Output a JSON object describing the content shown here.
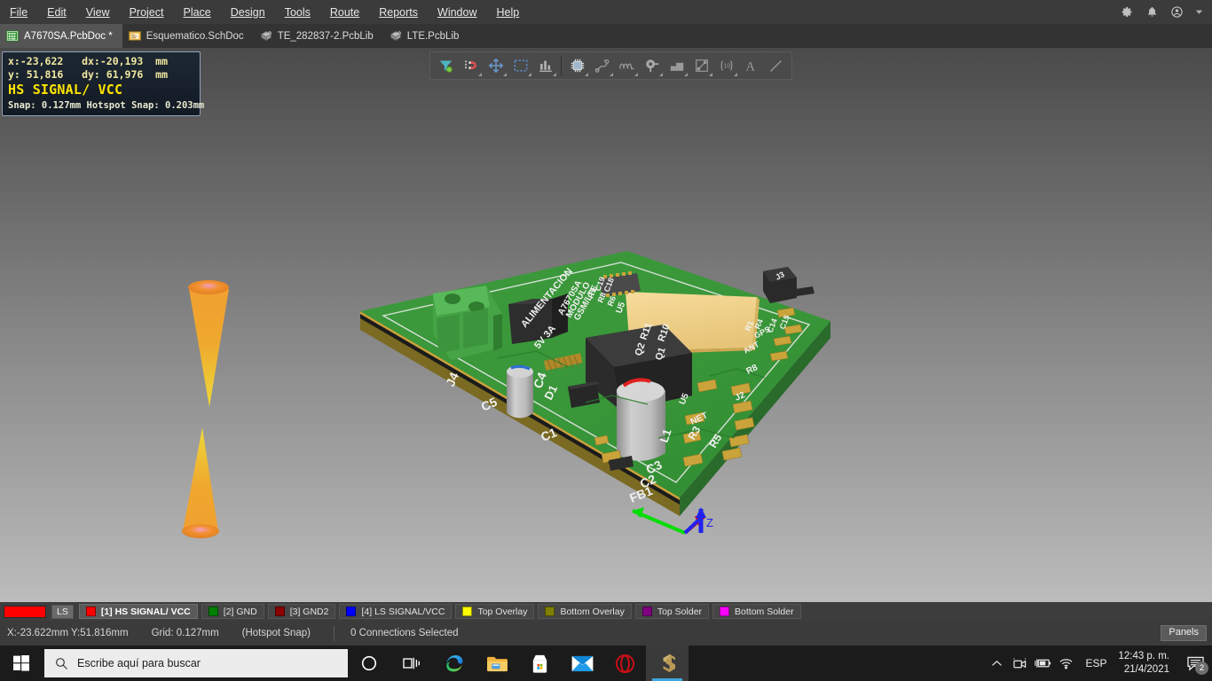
{
  "menu": {
    "items": [
      {
        "label": "File",
        "accel": "F"
      },
      {
        "label": "Edit",
        "accel": "E"
      },
      {
        "label": "View",
        "accel": "V"
      },
      {
        "label": "Project",
        "accel": "j"
      },
      {
        "label": "Place",
        "accel": "P"
      },
      {
        "label": "Design",
        "accel": "D"
      },
      {
        "label": "Tools",
        "accel": "T"
      },
      {
        "label": "Route",
        "accel": "u"
      },
      {
        "label": "Reports",
        "accel": "R"
      },
      {
        "label": "Window",
        "accel": "W"
      },
      {
        "label": "Help",
        "accel": "H"
      }
    ],
    "window_icons": [
      "gear-icon",
      "bell-icon",
      "account-icon",
      "chevron-down-icon"
    ]
  },
  "tabs": [
    {
      "label": "A7670SA.PcbDoc *",
      "icon": "pcbdoc-icon",
      "active": true
    },
    {
      "label": "Esquematico.SchDoc",
      "icon": "schdoc-icon",
      "active": false
    },
    {
      "label": "TE_282837-2.PcbLib",
      "icon": "pcblib-icon",
      "active": false
    },
    {
      "label": "LTE.PcbLib",
      "icon": "pcblib-icon",
      "active": false
    }
  ],
  "hud": {
    "line1": "x:-23,622   dx:-20,193  mm",
    "line2": "y: 51,816   dy: 61,976  mm",
    "net": "HS SIGNAL/ VCC",
    "snap": "Snap: 0.127mm Hotspot Snap: 0.203mm"
  },
  "toolbar": {
    "buttons": [
      {
        "name": "filter-icon",
        "caret": false
      },
      {
        "name": "magnet-snap-icon",
        "caret": false
      },
      {
        "name": "move-crosshair-icon",
        "caret": true
      },
      {
        "name": "area-select-icon",
        "caret": true
      },
      {
        "name": "align-icon",
        "caret": true
      },
      {
        "name": "place-component-icon",
        "caret": true
      },
      {
        "name": "route-trace-icon",
        "caret": true
      },
      {
        "name": "interactive-length-tuning-icon",
        "caret": true
      },
      {
        "name": "place-via-icon",
        "caret": true
      },
      {
        "name": "place-polygon-icon",
        "caret": true
      },
      {
        "name": "place-dimension-icon",
        "caret": true
      },
      {
        "name": "place-coordinate-icon",
        "caret": true
      },
      {
        "name": "place-string-icon",
        "caret": false
      },
      {
        "name": "place-line-icon",
        "caret": false
      }
    ]
  },
  "board": {
    "designators": [
      "J4",
      "C5",
      "C4",
      "C1",
      "D1",
      "C3",
      "C2",
      "FB1",
      "L1",
      "R3",
      "R5",
      "R11",
      "R10",
      "Q2",
      "Q1",
      "U5",
      "U3",
      "J2",
      "J3",
      "C19",
      "C18",
      "R9",
      "R8",
      "R6",
      "NET",
      "ANT",
      "GPS",
      "C15",
      "C14",
      "R4",
      "R1"
    ],
    "silkscreen": [
      "ALIMENTACION",
      "5V 3A",
      "A7670SA",
      "MODULO",
      "GSM/LTE"
    ],
    "axis_labels": [
      "Z"
    ],
    "colors": {
      "solder_mask": "#2f8f2f",
      "copper_pad": "#d8a94a",
      "silkscreen": "#ffffff",
      "component_black": "#2e2e2e",
      "connector_green": "#3f9e3f",
      "shield_gold": "#f2d28a",
      "axis_x": "#00e000",
      "axis_y": "#e00000",
      "axis_z": "#2020ff"
    },
    "net_probes": [
      {
        "name": "net-probe-cone-upper"
      },
      {
        "name": "net-probe-cone-lower"
      }
    ]
  },
  "layers": [
    {
      "label": "LS",
      "color": "#ff0000",
      "current_swatch": true
    },
    {
      "label": "[1] HS SIGNAL/ VCC",
      "color": "#ff0000",
      "selected": true
    },
    {
      "label": "[2] GND",
      "color": "#008000",
      "selected": false
    },
    {
      "label": "[3] GND2",
      "color": "#8b0000",
      "selected": false
    },
    {
      "label": "[4] LS SIGNAL/VCC",
      "color": "#0000ff",
      "selected": false
    },
    {
      "label": "Top Overlay",
      "color": "#ffff00",
      "selected": false
    },
    {
      "label": "Bottom Overlay",
      "color": "#808000",
      "selected": false
    },
    {
      "label": "Top Solder",
      "color": "#800080",
      "selected": false
    },
    {
      "label": "Bottom Solder",
      "color": "#ff00ff",
      "selected": false
    }
  ],
  "status": {
    "coords": "X:-23.622mm Y:51.816mm",
    "grid": "Grid: 0.127mm",
    "snap": "(Hotspot Snap)",
    "connections": "0 Connections Selected",
    "panels_label": "Panels"
  },
  "taskbar": {
    "search_placeholder": "Escribe aquí para buscar",
    "apps": [
      {
        "name": "cortana-icon"
      },
      {
        "name": "task-view-icon"
      },
      {
        "name": "edge-icon"
      },
      {
        "name": "file-explorer-icon"
      },
      {
        "name": "microsoft-store-icon"
      },
      {
        "name": "mail-icon"
      },
      {
        "name": "opera-icon"
      },
      {
        "name": "altium-designer-icon",
        "active": true
      }
    ],
    "tray": {
      "show_hidden": "chevron-up-icon",
      "icons": [
        "camera-icon",
        "battery-charging-icon",
        "wifi-icon"
      ],
      "language": "ESP",
      "time": "12:43 p. m.",
      "date": "21/4/2021",
      "notification_count": "2"
    }
  }
}
